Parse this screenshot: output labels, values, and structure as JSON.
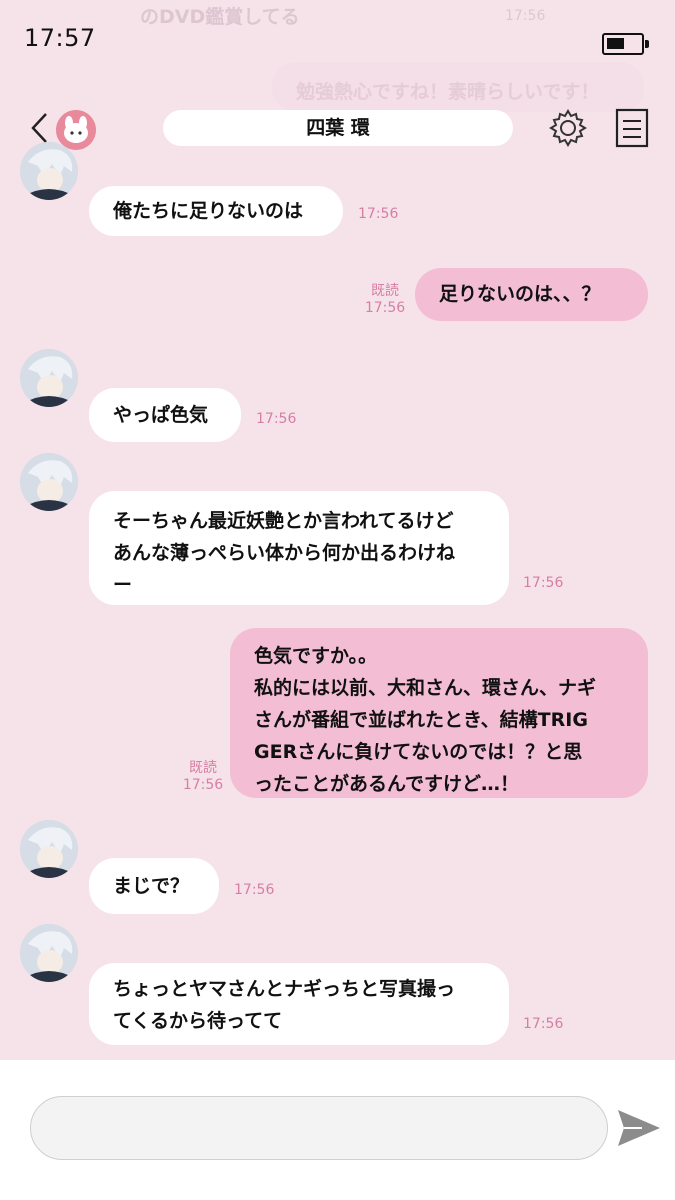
{
  "status": {
    "time": "17:57"
  },
  "background_snippets": {
    "top_text": "のDVD鑑賞してる",
    "top_time": "17:56",
    "bubble_text": "勉強熱心ですね！素晴らしいです！"
  },
  "header": {
    "title": "四葉 環",
    "back_icon": "chevron-left-icon",
    "settings_icon": "gear-icon",
    "memo_icon": "notes-icon"
  },
  "messages": [
    {
      "side": "left",
      "text": "俺たちに足りないのは",
      "time": "17:56"
    },
    {
      "side": "right",
      "text": "足りないのは、、？",
      "read": "既読",
      "time": "17:56"
    },
    {
      "side": "left",
      "text": "やっぱ色気",
      "time": "17:56"
    },
    {
      "side": "left",
      "text": "そーちゃん最近妖艶とか言われてるけど\nあんな薄っぺらい体から何か出るわけね\nー",
      "time": "17:56"
    },
    {
      "side": "right",
      "text": "色気ですか。。\n私的には以前、大和さん、環さん、ナギ\nさんが番組で並ばれたとき、結構TRIG\nGERさんに負けてないのでは！？と思\nったことがあるんですけど…！",
      "read": "既読",
      "time": "17:56"
    },
    {
      "side": "left",
      "text": "まじで？",
      "time": "17:56"
    },
    {
      "side": "left",
      "text": "ちょっとヤマさんとナギっちと写真撮っ\nてくるから待ってて",
      "time": "17:56"
    }
  ],
  "input": {
    "value": "",
    "placeholder": ""
  },
  "colors": {
    "background": "#f6e3ea",
    "own_bubble": "#f3bdd3",
    "accent_text": "#d77ea3"
  }
}
